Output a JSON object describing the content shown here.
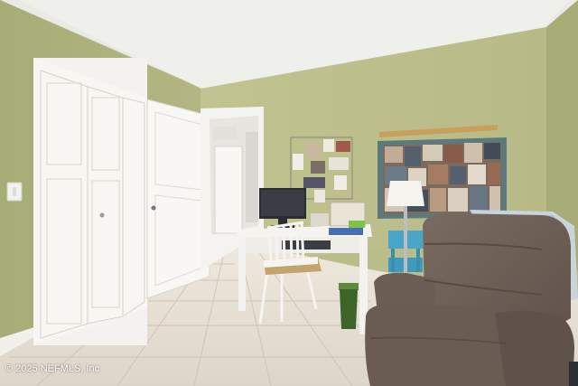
{
  "photo": {
    "subject": "bedroom-office-interior",
    "watermark": "© 2025 NEFMLS, Inc"
  },
  "colors": {
    "wall": "#b7bb86",
    "ceiling": "#ececea",
    "floor": "#e4ddd2",
    "door": "#f7f6f2",
    "recliner": "#6e5f56",
    "bin": "#3f6b2a",
    "shelf_cart": "#49a8c9"
  }
}
